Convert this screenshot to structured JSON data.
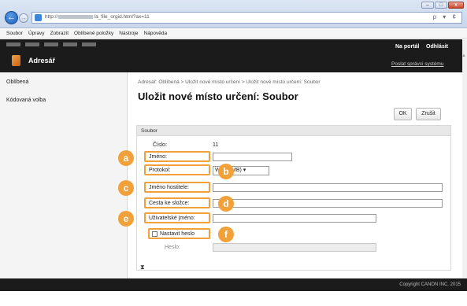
{
  "domain": "Computer-Use",
  "browser": {
    "back_glyph": "←",
    "fwd_glyph": "→",
    "url_prefix": "http://",
    "url_mid": "/a_file_orgid.html?ax=11",
    "addr_tools": "ρ ▾ ¢",
    "win_minimize": "–",
    "win_maximize": "□",
    "win_close": "x",
    "menu": [
      "Soubor",
      "Úpravy",
      "Zobrazit",
      "Oblíbené položky",
      "Nástroje",
      "Nápověda"
    ]
  },
  "header": {
    "title": "Adresář",
    "portal_link": "Na portál",
    "logout_link": "Odhlásit",
    "admin_link": "Poslat správci systému"
  },
  "sidebar": {
    "items": [
      "Oblíbená",
      "Kódovaná volba"
    ]
  },
  "main": {
    "breadcrumb": "Adresář: Oblíbená > Uložit nové místo určení > Uložit nové místo určení: Soubor",
    "title": "Uložit nové místo určení: Soubor",
    "ok_label": "OK",
    "cancel_label": "Zrušit",
    "section_title": "Soubor",
    "fields": {
      "number_label": "Číslo:",
      "number_value": "11",
      "name_label": "Jméno:",
      "protocol_label": "Protokol:",
      "protocol_value": "W... (SMB) ▾",
      "host_label": "Jméno hostitele:",
      "folder_label": "Cesta ke složce:",
      "user_label": "Uživatelské jméno:",
      "set_password_label": "Nastavit heslo",
      "password_label": "Heslo:"
    },
    "footer_icon": "⧗"
  },
  "callouts": [
    "a",
    "b",
    "c",
    "d",
    "e",
    "f"
  ],
  "footer": {
    "copyright": "Copyright CANON INC. 2015"
  },
  "colors": {
    "accent": "#f2a13a",
    "header_bg": "#1b1b1b",
    "sidebar_bg": "#f4f4f4"
  }
}
